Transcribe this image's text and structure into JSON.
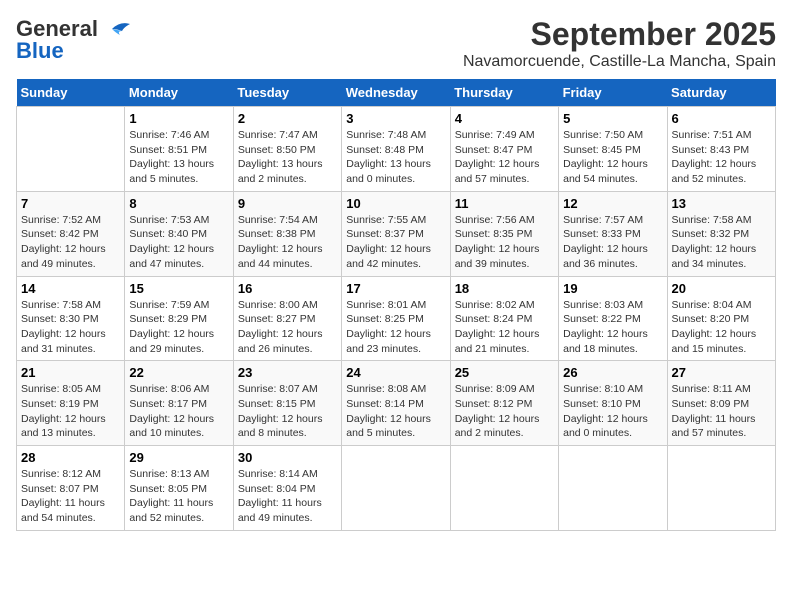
{
  "header": {
    "logo_line1": "General",
    "logo_line2": "Blue",
    "title": "September 2025",
    "subtitle": "Navamorcuende, Castille-La Mancha, Spain"
  },
  "days_of_week": [
    "Sunday",
    "Monday",
    "Tuesday",
    "Wednesday",
    "Thursday",
    "Friday",
    "Saturday"
  ],
  "weeks": [
    [
      {
        "day": "",
        "info": ""
      },
      {
        "day": "1",
        "info": "Sunrise: 7:46 AM\nSunset: 8:51 PM\nDaylight: 13 hours\nand 5 minutes."
      },
      {
        "day": "2",
        "info": "Sunrise: 7:47 AM\nSunset: 8:50 PM\nDaylight: 13 hours\nand 2 minutes."
      },
      {
        "day": "3",
        "info": "Sunrise: 7:48 AM\nSunset: 8:48 PM\nDaylight: 13 hours\nand 0 minutes."
      },
      {
        "day": "4",
        "info": "Sunrise: 7:49 AM\nSunset: 8:47 PM\nDaylight: 12 hours\nand 57 minutes."
      },
      {
        "day": "5",
        "info": "Sunrise: 7:50 AM\nSunset: 8:45 PM\nDaylight: 12 hours\nand 54 minutes."
      },
      {
        "day": "6",
        "info": "Sunrise: 7:51 AM\nSunset: 8:43 PM\nDaylight: 12 hours\nand 52 minutes."
      }
    ],
    [
      {
        "day": "7",
        "info": "Sunrise: 7:52 AM\nSunset: 8:42 PM\nDaylight: 12 hours\nand 49 minutes."
      },
      {
        "day": "8",
        "info": "Sunrise: 7:53 AM\nSunset: 8:40 PM\nDaylight: 12 hours\nand 47 minutes."
      },
      {
        "day": "9",
        "info": "Sunrise: 7:54 AM\nSunset: 8:38 PM\nDaylight: 12 hours\nand 44 minutes."
      },
      {
        "day": "10",
        "info": "Sunrise: 7:55 AM\nSunset: 8:37 PM\nDaylight: 12 hours\nand 42 minutes."
      },
      {
        "day": "11",
        "info": "Sunrise: 7:56 AM\nSunset: 8:35 PM\nDaylight: 12 hours\nand 39 minutes."
      },
      {
        "day": "12",
        "info": "Sunrise: 7:57 AM\nSunset: 8:33 PM\nDaylight: 12 hours\nand 36 minutes."
      },
      {
        "day": "13",
        "info": "Sunrise: 7:58 AM\nSunset: 8:32 PM\nDaylight: 12 hours\nand 34 minutes."
      }
    ],
    [
      {
        "day": "14",
        "info": "Sunrise: 7:58 AM\nSunset: 8:30 PM\nDaylight: 12 hours\nand 31 minutes."
      },
      {
        "day": "15",
        "info": "Sunrise: 7:59 AM\nSunset: 8:29 PM\nDaylight: 12 hours\nand 29 minutes."
      },
      {
        "day": "16",
        "info": "Sunrise: 8:00 AM\nSunset: 8:27 PM\nDaylight: 12 hours\nand 26 minutes."
      },
      {
        "day": "17",
        "info": "Sunrise: 8:01 AM\nSunset: 8:25 PM\nDaylight: 12 hours\nand 23 minutes."
      },
      {
        "day": "18",
        "info": "Sunrise: 8:02 AM\nSunset: 8:24 PM\nDaylight: 12 hours\nand 21 minutes."
      },
      {
        "day": "19",
        "info": "Sunrise: 8:03 AM\nSunset: 8:22 PM\nDaylight: 12 hours\nand 18 minutes."
      },
      {
        "day": "20",
        "info": "Sunrise: 8:04 AM\nSunset: 8:20 PM\nDaylight: 12 hours\nand 15 minutes."
      }
    ],
    [
      {
        "day": "21",
        "info": "Sunrise: 8:05 AM\nSunset: 8:19 PM\nDaylight: 12 hours\nand 13 minutes."
      },
      {
        "day": "22",
        "info": "Sunrise: 8:06 AM\nSunset: 8:17 PM\nDaylight: 12 hours\nand 10 minutes."
      },
      {
        "day": "23",
        "info": "Sunrise: 8:07 AM\nSunset: 8:15 PM\nDaylight: 12 hours\nand 8 minutes."
      },
      {
        "day": "24",
        "info": "Sunrise: 8:08 AM\nSunset: 8:14 PM\nDaylight: 12 hours\nand 5 minutes."
      },
      {
        "day": "25",
        "info": "Sunrise: 8:09 AM\nSunset: 8:12 PM\nDaylight: 12 hours\nand 2 minutes."
      },
      {
        "day": "26",
        "info": "Sunrise: 8:10 AM\nSunset: 8:10 PM\nDaylight: 12 hours\nand 0 minutes."
      },
      {
        "day": "27",
        "info": "Sunrise: 8:11 AM\nSunset: 8:09 PM\nDaylight: 11 hours\nand 57 minutes."
      }
    ],
    [
      {
        "day": "28",
        "info": "Sunrise: 8:12 AM\nSunset: 8:07 PM\nDaylight: 11 hours\nand 54 minutes."
      },
      {
        "day": "29",
        "info": "Sunrise: 8:13 AM\nSunset: 8:05 PM\nDaylight: 11 hours\nand 52 minutes."
      },
      {
        "day": "30",
        "info": "Sunrise: 8:14 AM\nSunset: 8:04 PM\nDaylight: 11 hours\nand 49 minutes."
      },
      {
        "day": "",
        "info": ""
      },
      {
        "day": "",
        "info": ""
      },
      {
        "day": "",
        "info": ""
      },
      {
        "day": "",
        "info": ""
      }
    ]
  ]
}
